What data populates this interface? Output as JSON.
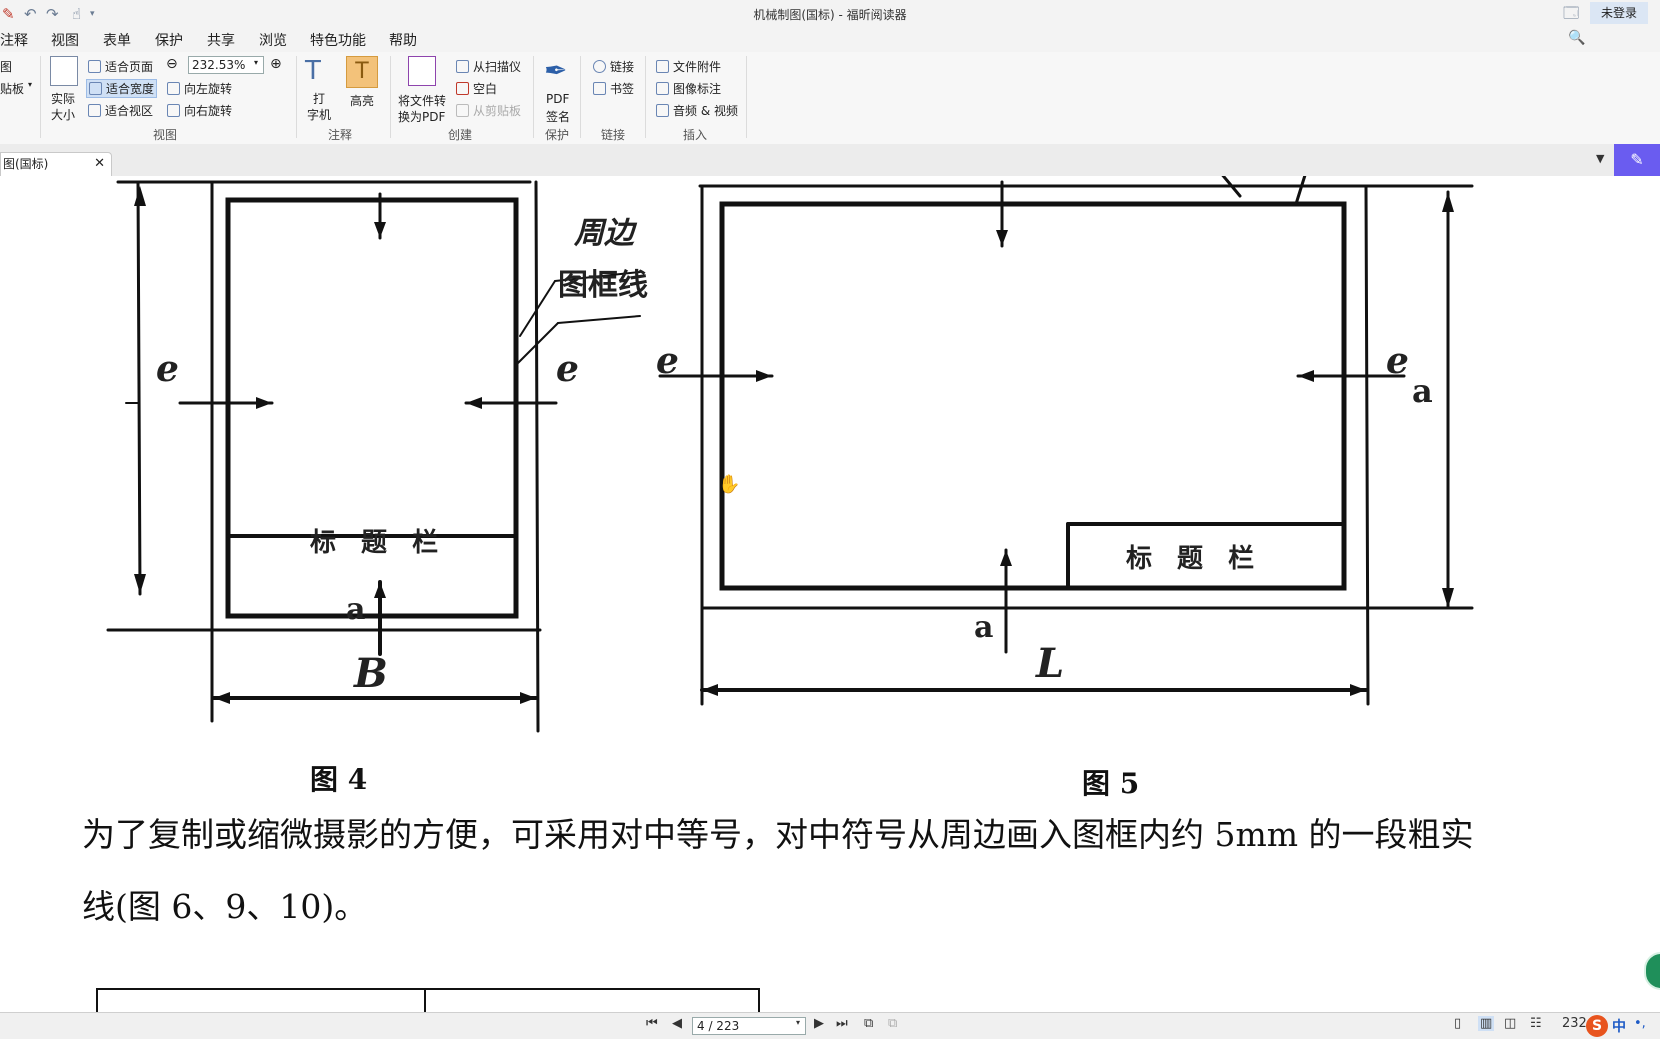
{
  "window": {
    "title": "机械制图(国标) - 福昕阅读器",
    "login_label": "未登录",
    "search_placeholder": "查找"
  },
  "menu": [
    "注释",
    "视图",
    "表单",
    "保护",
    "共享",
    "浏览",
    "特色功能",
    "帮助"
  ],
  "ribbon": {
    "clip_fragment_1": "图",
    "clip_fragment_2": "贴板",
    "actual_size": [
      "实际",
      "大小"
    ],
    "fit_page": "适合页面",
    "fit_width": "适合宽度",
    "fit_view": "适合视区",
    "zoom_value": "232.53%",
    "rotate_left": "向左旋转",
    "rotate_right": "向右旋转",
    "group_view": "视图",
    "typewriter": [
      "打",
      "字机"
    ],
    "highlight": "高亮",
    "group_comment": "注释",
    "to_pdf": [
      "将文件转",
      "换为PDF"
    ],
    "from_scanner": "从扫描仪",
    "blank": "空白",
    "from_clipboard": "从剪贴板",
    "group_create": "创建",
    "pdf_sign": [
      "PDF",
      "签名"
    ],
    "group_protect": "保护",
    "link": "链接",
    "bookmark": "书签",
    "group_links": "链接",
    "file_attachment": "文件附件",
    "image_annotation": "图像标注",
    "audio_video": "音频 & 视频",
    "group_insert": "插入"
  },
  "tab": {
    "label": "图(国标)",
    "close": "✕"
  },
  "document": {
    "fig4": {
      "labels": [
        "周边",
        "图框线"
      ],
      "e_left": "e",
      "e_right": "e",
      "title_block": "标 题 栏",
      "a_mark": "a",
      "b_label": "B",
      "caption": "图 4"
    },
    "fig5": {
      "e_left": "e",
      "e_right": "e",
      "a_right": "a",
      "title_block": "标 题 栏",
      "a_mark": "a",
      "l_label": "L",
      "caption": "图 5"
    },
    "paragraph_line1": "为了复制或缩微摄影的方便，可采用对中等号，对中符号从周边画入图框内约 5mm 的一段粗实",
    "paragraph_line2": "线(图 6、9、10)。"
  },
  "statusbar": {
    "page_indicator": "4 / 223",
    "zoom_fragment": "232"
  },
  "ime": {
    "label": "中"
  }
}
